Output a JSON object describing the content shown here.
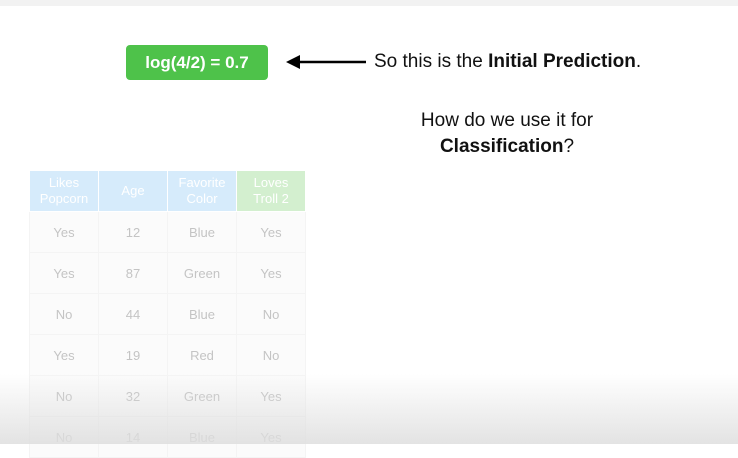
{
  "prediction_box": "log(4/2) = 0.7",
  "caption_line1_prefix": "So this is the ",
  "caption_line1_bold": "Initial Prediction",
  "caption_line1_suffix": ".",
  "caption_line2_a": "How do we use it for",
  "caption_line2_bold": "Classification",
  "caption_line2_suffix": "?",
  "table": {
    "headers": [
      [
        "Likes",
        "Popcorn"
      ],
      [
        "Age"
      ],
      [
        "Favorite",
        "Color"
      ],
      [
        "Loves",
        "Troll 2"
      ]
    ],
    "rows": [
      [
        "Yes",
        "12",
        "Blue",
        "Yes"
      ],
      [
        "Yes",
        "87",
        "Green",
        "Yes"
      ],
      [
        "No",
        "44",
        "Blue",
        "No"
      ],
      [
        "Yes",
        "19",
        "Red",
        "No"
      ],
      [
        "No",
        "32",
        "Green",
        "Yes"
      ],
      [
        "No",
        "14",
        "Blue",
        "Yes"
      ]
    ]
  },
  "colors": {
    "prediction_green": "#4ec24a",
    "header_blue": "#d6ebfb",
    "header_green": "#d3efcf"
  },
  "icons": {
    "arrow": "left-arrow-icon"
  }
}
